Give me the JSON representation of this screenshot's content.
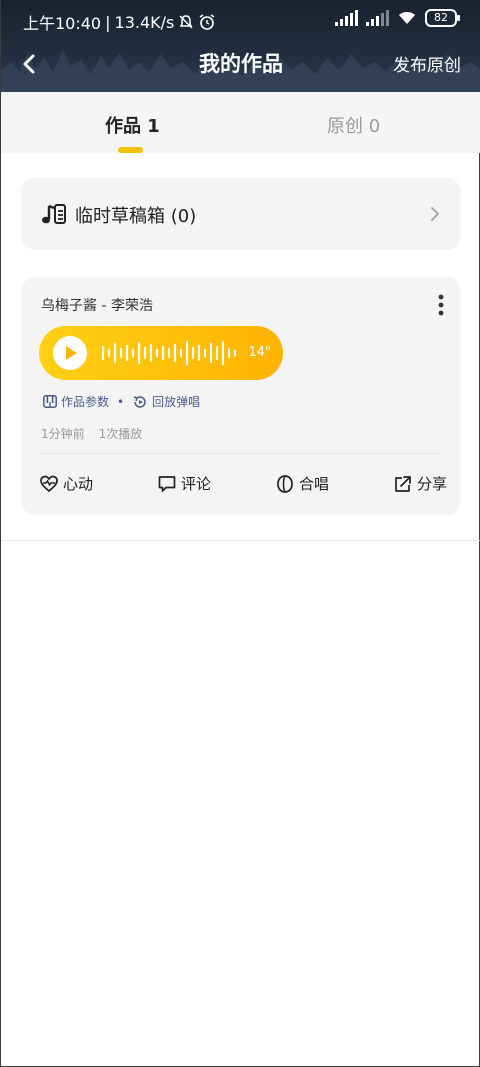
{
  "statusbar": {
    "time": "上午10:40",
    "network_speed": "13.4K/s",
    "battery": "82",
    "icons": [
      "mute-bell-icon",
      "alarm-icon",
      "signal-icon",
      "wifi-icon",
      "battery-icon"
    ]
  },
  "navbar": {
    "title": "我的作品",
    "action": "发布原创",
    "back_icon": "back-arrow-icon"
  },
  "tabs": [
    {
      "label": "作品 1",
      "active": true
    },
    {
      "label": "原创 0",
      "active": false
    }
  ],
  "draft": {
    "label": "临时草稿箱 (0)",
    "icon": "music-note-list-icon"
  },
  "work": {
    "title": "乌梅子酱 - 李荣浩",
    "duration": "14\"",
    "params_label": "作品参数",
    "replay_label": "回放弹唱",
    "time_ago": "1分钟前",
    "plays": "1次播放",
    "actions": {
      "like": "心动",
      "comment": "评论",
      "chorus": "合唱",
      "share": "分享"
    }
  },
  "colors": {
    "accent": "#f5c400",
    "player_start": "#ffd015",
    "player_end": "#ffb300",
    "link": "#4a5c8a",
    "header_bg": "#1f2a3a"
  }
}
